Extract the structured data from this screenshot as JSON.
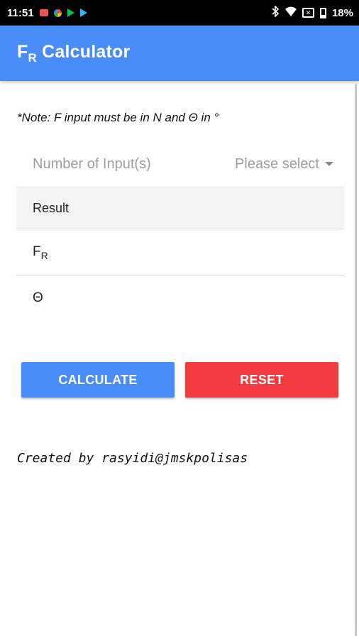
{
  "status_bar": {
    "time": "11:51",
    "battery": "18%",
    "notification_icons": [
      "mail-icon",
      "photos-icon",
      "play-store-icon",
      "play-movies-icon"
    ],
    "system_icons": [
      "bluetooth-icon",
      "wifi-icon",
      "no-sim-icon",
      "battery-icon"
    ]
  },
  "app_bar": {
    "title_main": "F",
    "title_sub": "R",
    "title_rest": " Calculator",
    "color": "#4a8cf7"
  },
  "note": "*Note: F input must be in N and Θ in °",
  "inputs_selector": {
    "label": "Number of Input(s)",
    "value": "Please select"
  },
  "result": {
    "header": "Result",
    "fr_main": "F",
    "fr_sub": "R",
    "theta": "Θ"
  },
  "buttons": {
    "calculate": "CALCULATE",
    "reset": "RESET",
    "calculate_color": "#4a8cf7",
    "reset_color": "#f23b3f"
  },
  "footer": {
    "credit": "Created by rasyidi@jmskpolisas"
  }
}
